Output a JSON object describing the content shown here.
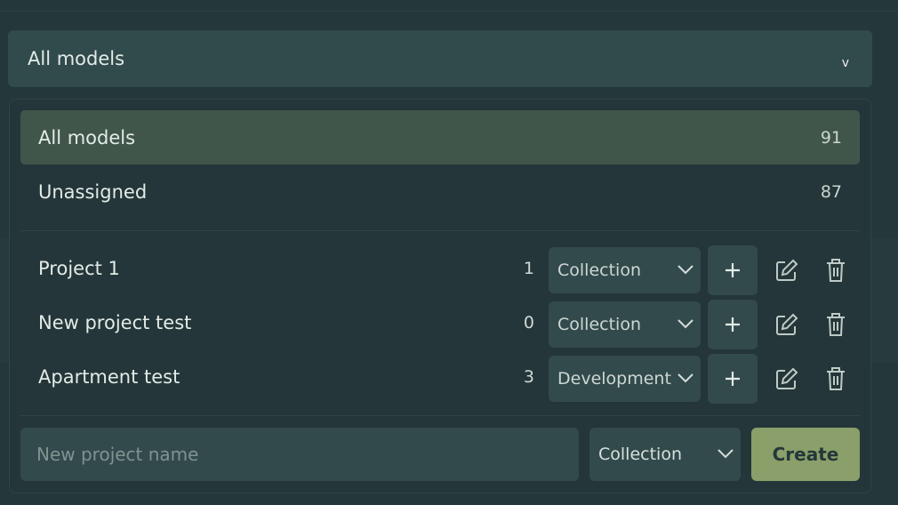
{
  "model_filter": {
    "selected_label": "All models",
    "caret_icon": "chevron-down-icon"
  },
  "dropdown": {
    "filters": [
      {
        "label": "All models",
        "count": "91",
        "active": true
      },
      {
        "label": "Unassigned",
        "count": "87",
        "active": false
      }
    ],
    "projects": [
      {
        "name": "Project 1",
        "count": "1",
        "type": "Collection"
      },
      {
        "name": "New project test",
        "count": "0",
        "type": "Collection"
      },
      {
        "name": "Apartment test",
        "count": "3",
        "type": "Development"
      }
    ],
    "new_project": {
      "placeholder": "New project name",
      "type": "Collection",
      "create_label": "Create"
    }
  },
  "colors": {
    "background": "#24373a",
    "control": "#324a4c",
    "active_row": "#41564a",
    "create_button": "#8a9f69"
  }
}
